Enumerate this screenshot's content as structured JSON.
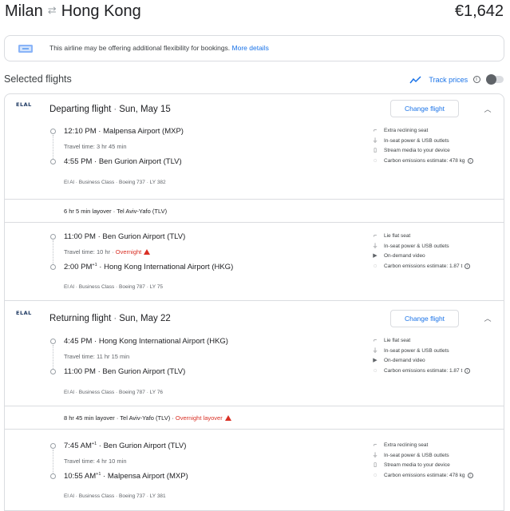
{
  "header": {
    "origin": "Milan",
    "destination": "Hong Kong",
    "price": "€1,642"
  },
  "notice": {
    "text": "This airline may be offering additional flexibility for bookings.",
    "link": "More details"
  },
  "selected": {
    "title": "Selected flights",
    "track_label": "Track prices",
    "track_on": false
  },
  "departing": {
    "label": "Departing flight",
    "date": "Sun, May 15",
    "change_label": "Change flight",
    "airline_logo": "ELAL",
    "segments": [
      {
        "dep_time": "12:10 PM",
        "dep_airport": "Malpensa Airport (MXP)",
        "travel": "Travel time: 3 hr 45 min",
        "overnight": "",
        "arr_time": "4:55 PM",
        "arr_sup": "",
        "arr_airport": "Ben Gurion Airport (TLV)",
        "meta": "El Al · Business Class · Boeing 737 · LY 382",
        "amenities": [
          {
            "icon": "seat-icon",
            "text": "Extra reclining seat"
          },
          {
            "icon": "power-icon",
            "text": "In-seat power & USB outlets"
          },
          {
            "icon": "stream-icon",
            "text": "Stream media to your device"
          },
          {
            "icon": "co2-icon",
            "text": "Carbon emissions estimate: 478 kg"
          }
        ]
      },
      {
        "dep_time": "11:00 PM",
        "dep_airport": "Ben Gurion Airport (TLV)",
        "travel": "Travel time: 10 hr",
        "overnight": "Overnight",
        "arr_time": "2:00 PM",
        "arr_sup": "+1",
        "arr_airport": "Hong Kong International Airport (HKG)",
        "meta": "El Al · Business Class · Boeing 787 · LY 75",
        "amenities": [
          {
            "icon": "seat-icon",
            "text": "Lie flat seat"
          },
          {
            "icon": "power-icon",
            "text": "In-seat power & USB outlets"
          },
          {
            "icon": "video-icon",
            "text": "On-demand video"
          },
          {
            "icon": "co2-icon",
            "text": "Carbon emissions estimate: 1.87 t"
          }
        ]
      }
    ],
    "layover": {
      "text": "6 hr 5 min layover · Tel Aviv-Yafo (TLV)",
      "overnight": ""
    }
  },
  "returning": {
    "label": "Returning flight",
    "date": "Sun, May 22",
    "change_label": "Change flight",
    "airline_logo": "ELAL",
    "segments": [
      {
        "dep_time": "4:45 PM",
        "dep_sup": "",
        "dep_airport": "Hong Kong International Airport (HKG)",
        "travel": "Travel time: 11 hr 15 min",
        "overnight": "",
        "arr_time": "11:00 PM",
        "arr_sup": "",
        "arr_airport": "Ben Gurion Airport (TLV)",
        "meta": "El Al · Business Class · Boeing 787 · LY 76",
        "amenities": [
          {
            "icon": "seat-icon",
            "text": "Lie flat seat"
          },
          {
            "icon": "power-icon",
            "text": "In-seat power & USB outlets"
          },
          {
            "icon": "video-icon",
            "text": "On-demand video"
          },
          {
            "icon": "co2-icon",
            "text": "Carbon emissions estimate: 1.87 t"
          }
        ]
      },
      {
        "dep_time": "7:45 AM",
        "dep_sup": "+1",
        "dep_airport": "Ben Gurion Airport (TLV)",
        "travel": "Travel time: 4 hr 10 min",
        "overnight": "",
        "arr_time": "10:55 AM",
        "arr_sup": "+1",
        "arr_airport": "Malpensa Airport (MXP)",
        "meta": "El Al · Business Class · Boeing 737 · LY 381",
        "amenities": [
          {
            "icon": "seat-icon",
            "text": "Extra reclining seat"
          },
          {
            "icon": "power-icon",
            "text": "In-seat power & USB outlets"
          },
          {
            "icon": "stream-icon",
            "text": "Stream media to your device"
          },
          {
            "icon": "co2-icon",
            "text": "Carbon emissions estimate: 478 kg"
          }
        ]
      }
    ],
    "layover": {
      "text": "8 hr 45 min layover · Tel Aviv-Yafo (TLV) · ",
      "overnight": "Overnight layover"
    }
  },
  "colors": {
    "accent": "#1a73e8",
    "warning": "#d93025",
    "border": "#dadce0",
    "logo": "#1f3a63"
  }
}
